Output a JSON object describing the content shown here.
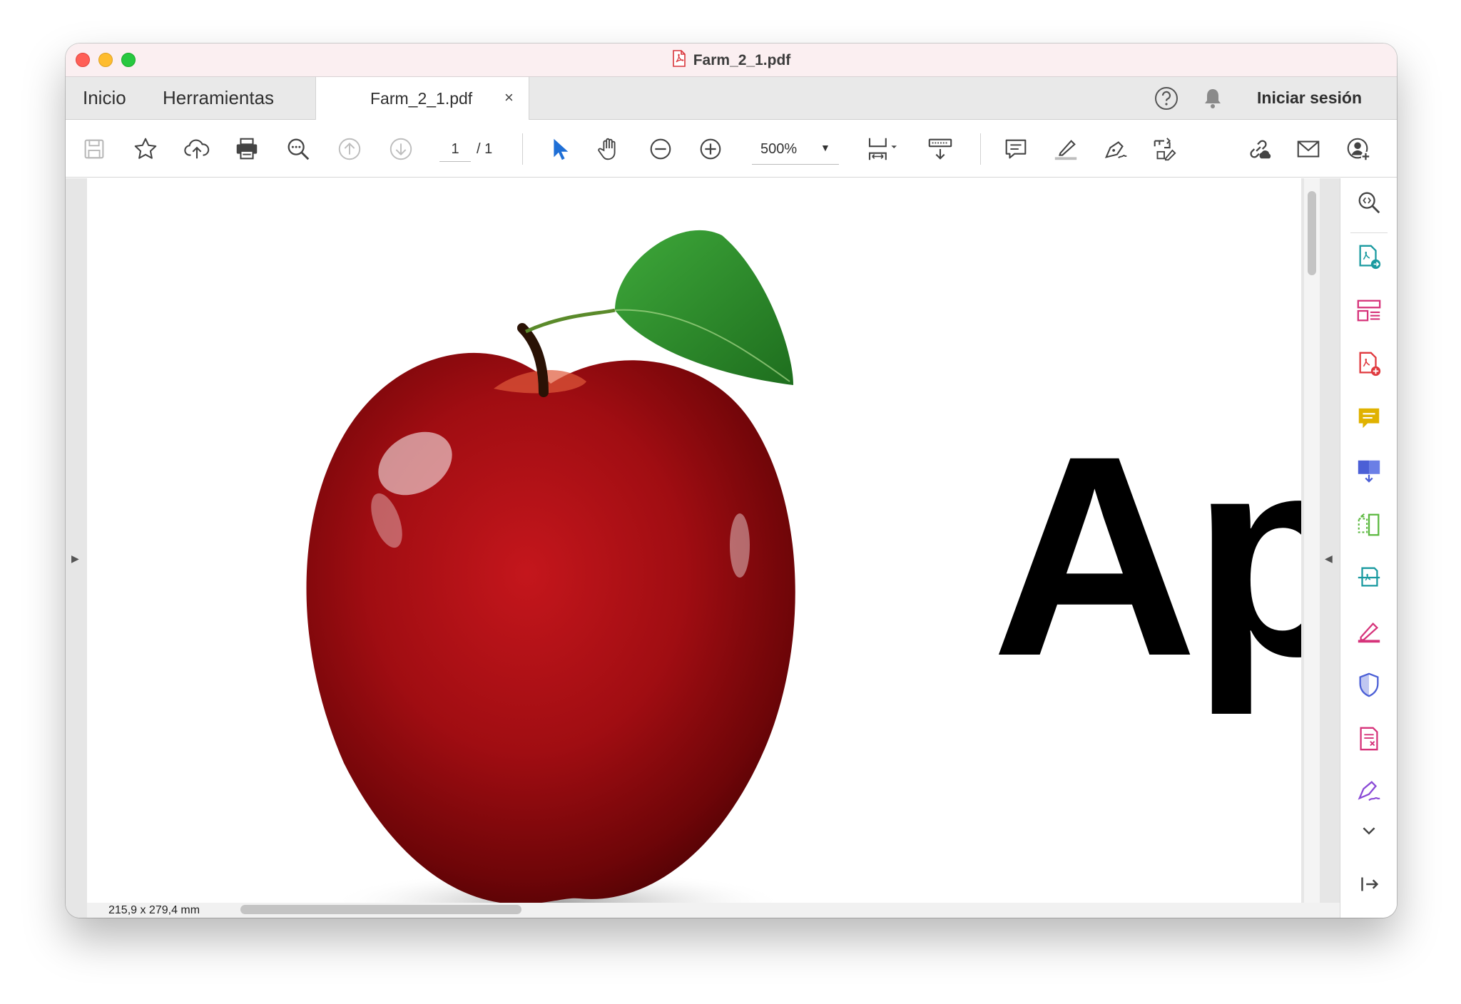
{
  "window": {
    "title": "Farm_2_1.pdf"
  },
  "tabs": {
    "home": "Inicio",
    "tools": "Herramientas",
    "document": "Farm_2_1.pdf",
    "close": "×"
  },
  "account": {
    "sign_in": "Iniciar sesión"
  },
  "toolbar": {
    "icons": [
      "save-icon",
      "bookmark-star-icon",
      "upload-cloud-icon",
      "print-icon",
      "find-icon",
      "prev-page-icon",
      "next-page-icon",
      "select-arrow-icon",
      "hand-icon",
      "zoom-out-icon",
      "zoom-in-icon",
      "page-fit-icon",
      "scrolling-mode-icon",
      "comment-icon",
      "highlight-icon",
      "sign-icon",
      "edit-pdf-icon",
      "share-link-icon",
      "email-icon",
      "add-user-icon"
    ],
    "page_current": "1",
    "page_total": "/ 1",
    "zoom": "500%"
  },
  "document": {
    "page_text": "Ap",
    "dimensions": "215,9 x 279,4 mm"
  },
  "right_panel": {
    "icons": [
      "search-zoom-icon",
      "export-pdf-icon",
      "organize-pages-icon",
      "create-pdf-icon",
      "comment-tool-icon",
      "combine-files-icon",
      "compress-icon",
      "scan-icon",
      "fill-sign-icon",
      "protect-icon",
      "prepare-form-icon",
      "request-signature-icon",
      "more-tools-chevron-icon",
      "collapse-panel-icon"
    ],
    "colors": {
      "teal": "#1a9aa0",
      "pink": "#d6337a",
      "red": "#e0393e",
      "yellow": "#e0b200",
      "blue": "#4b5fd6",
      "green": "#5bb83f",
      "purple": "#8a4ad6"
    }
  }
}
